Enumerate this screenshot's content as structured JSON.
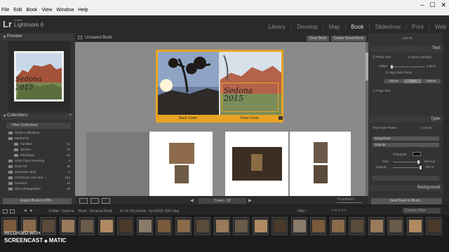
{
  "os_menu": [
    "File",
    "Edit",
    "Book",
    "View",
    "Window",
    "Help"
  ],
  "brand": {
    "logo": "Lr",
    "vendor": "Adobe",
    "product": "Lightroom 6"
  },
  "modules": [
    "Library",
    "Develop",
    "Map",
    "Book",
    "Slideshow",
    "Print",
    "Web"
  ],
  "active_module": "Book",
  "left": {
    "preview_label": "Preview",
    "preview_text": "Sedona 2015",
    "collections_label": "Collections",
    "filter_label": "Filter Collections",
    "collections": [
      {
        "name": "Smart Collections",
        "count": ""
      },
      {
        "name": "WEBSITE",
        "count": ""
      },
      {
        "name": "Families",
        "count": "12"
      },
      {
        "name": "Seniors",
        "count": "45"
      },
      {
        "name": "Weddings",
        "count": "41"
      },
      {
        "name": "2015 Client Roundup",
        "count": "3"
      },
      {
        "name": "2016 RB",
        "count": "19"
      },
      {
        "name": "Business cards",
        "count": "6"
      },
      {
        "name": "Christmas Card and ...",
        "count": "184"
      },
      {
        "name": "crawford",
        "count": "19"
      },
      {
        "name": "dear photographer",
        "count": "16"
      }
    ],
    "export_label": "Export Book to PDF..."
  },
  "center": {
    "tab_title": "Unsaved Book",
    "clear_label": "Clear Book",
    "save_label": "Create Saved Book",
    "back_cover_label": "Back Cover",
    "front_cover_label": "Front Cover",
    "cover_text": "Sedona 2015",
    "page_nav_label": "Cover - 32",
    "thumbnails_label": "Thumbnails"
  },
  "right": {
    "link_all": "Link All",
    "text_label": "Text",
    "photo_text": "Photo Text",
    "photo_text_value": "Custom Settings",
    "offset_label": "Offset",
    "offset_value": "0.00 in",
    "align_label": "Align With Photo",
    "align_buttons": [
      "Above",
      "Over",
      "Below"
    ],
    "page_text": "Page Text",
    "type_label": "Type",
    "style_preset_label": "Text Style Preset:",
    "style_preset_value": "Custom",
    "font_value": "Bringsheart",
    "style_value": "Regular",
    "character_label": "Character",
    "size_label": "Size",
    "size_value": "102.0 pt",
    "opacity_label": "Opacity",
    "opacity_value": "100 %",
    "background_label": "Background",
    "send_label": "Send Book to Blurb..."
  },
  "filmbar": {
    "path": "Folder : Sedona",
    "book_path": "Book : Unsaved Book",
    "count": "47 of 125 photos",
    "filename": "/nov2015-7657.dng",
    "filter_label": "Filter :",
    "filter_value": "Custom Filter"
  },
  "watermark": {
    "line1": "RECORDED WITH",
    "line2": "SCREENCAST",
    "line3": "MATIC"
  },
  "colors": {
    "accent": "#e9a322",
    "panel": "#333333",
    "canvas": "#8a8a8a"
  }
}
